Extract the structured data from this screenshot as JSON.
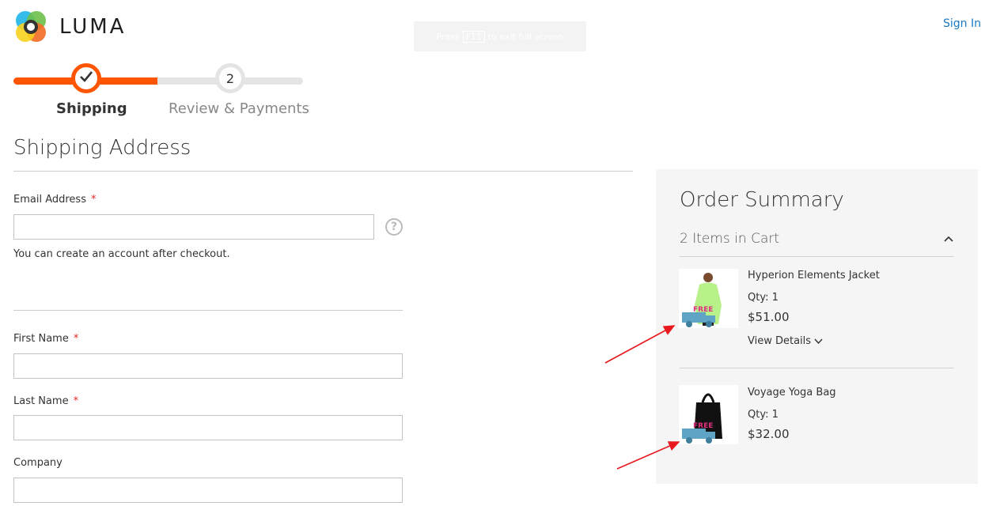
{
  "header": {
    "logo_text": "LUMA",
    "sign_in": "Sign In",
    "fullscreen_tip": {
      "before": "Press",
      "key": "F11",
      "after": "to exit full screen"
    }
  },
  "progress": {
    "steps": [
      {
        "number": "",
        "label": "Shipping",
        "state": "complete"
      },
      {
        "number": "2",
        "label": "Review & Payments",
        "state": "pending"
      }
    ],
    "accent_color": "#ff5501"
  },
  "shipping": {
    "title": "Shipping Address",
    "email": {
      "label": "Email Address",
      "value": "",
      "required_mark": "*"
    },
    "email_note": "You can create an account after checkout.",
    "first_name": {
      "label": "First Name",
      "value": "",
      "required_mark": "*"
    },
    "last_name": {
      "label": "Last Name",
      "value": "",
      "required_mark": "*"
    },
    "company": {
      "label": "Company",
      "value": ""
    }
  },
  "summary": {
    "title": "Order Summary",
    "cart_count": "2 Items in Cart",
    "items": [
      {
        "name": "Hyperion Elements Jacket",
        "qty": "Qty: 1",
        "price": "$51.00",
        "details_label": "View Details",
        "badge_text": "FREE"
      },
      {
        "name": "Voyage Yoga Bag",
        "qty": "Qty: 1",
        "price": "$32.00",
        "badge_text": "FREE"
      }
    ]
  },
  "icons": {
    "check": "check-icon",
    "help": "question-icon",
    "chevron_up": "chevron-up-icon",
    "chevron_down": "chevron-down-icon"
  },
  "colors": {
    "link": "#1979c3",
    "required": "#e02b27",
    "annotation_arrow": "#e8181e"
  }
}
